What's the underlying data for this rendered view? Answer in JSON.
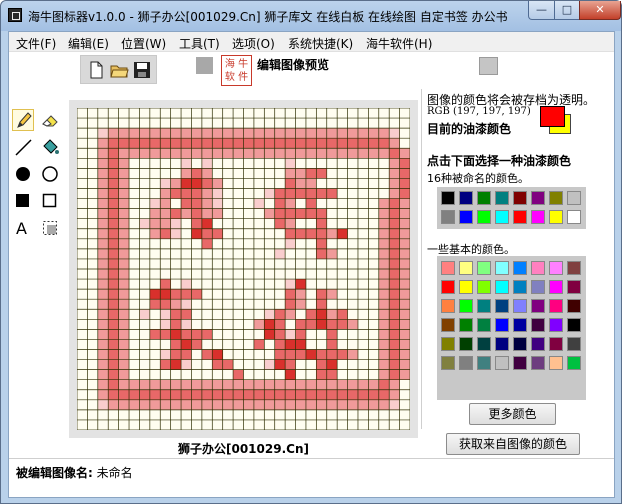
{
  "window": {
    "title": "海牛图标器v1.0.0 - 狮子办公[001029.Cn] 狮子库文 在线白板 在线绘图 自定书签 办公书...",
    "minimize_glyph": "—",
    "maximize_glyph": "□",
    "close_glyph": "✕"
  },
  "menu": {
    "items": [
      {
        "label": "文件(F)"
      },
      {
        "label": "编辑(E)"
      },
      {
        "label": "位置(W)"
      },
      {
        "label": "工具(T)"
      },
      {
        "label": "选项(O)"
      },
      {
        "label": "系统快捷(K)"
      },
      {
        "label": "海牛软件(H)"
      }
    ]
  },
  "toolbar": {
    "new_icon": "new-file-icon",
    "open_icon": "open-folder-icon",
    "save_icon": "save-disk-icon",
    "preview_label": "编辑图像预览",
    "stamp_text": "海牛软件",
    "preview_swatch_color": "#a8a8a8",
    "transparent_swatch_color": "#c5c5c5"
  },
  "tools": [
    {
      "icon": "pencil-icon",
      "selected": true
    },
    {
      "icon": "eraser-icon",
      "selected": false
    },
    {
      "icon": "line-icon",
      "selected": false
    },
    {
      "icon": "fill-bucket-icon",
      "selected": false
    },
    {
      "icon": "filled-circle-icon",
      "selected": false
    },
    {
      "icon": "outline-circle-icon",
      "selected": false
    },
    {
      "icon": "filled-rectangle-icon",
      "selected": false
    },
    {
      "icon": "outline-rectangle-icon",
      "selected": false
    },
    {
      "icon": "text-icon",
      "selected": false
    },
    {
      "icon": "select-region-icon",
      "selected": false
    }
  ],
  "canvas": {
    "grid_size": 32,
    "image_name_label": "狮子办公[001029.Cn]",
    "grid_line_color": "#2d2d00",
    "background_color": "#fffdf0",
    "colors": {
      "r": "#d9302c",
      "m": "#e86868",
      "p": "#f09a9a",
      "l": "#f9cdcd"
    },
    "pixels": [
      "................................",
      "................................",
      "..lpppppppppppppppppppppppppppl..",
      "..pmmmmmmmmmmmmmmmmmmmmmmmmmmmp..",
      "..pmppppppppppppppppppppppppppmp.",
      "..pmp.....l.l.......l.........pm.",
      "..pmp.....pmp.......ppmm......pm.",
      "..pmp...lprrmp......mpp.......pm.",
      "..pmp...pmmmpl....lmmmmmm.....pm.",
      "..pmp..lp.mmpl...l.mp.m......pmp",
      "..pmp..ppmpmpp....pmmmmm.....pmp",
      "..pmp.lppl.mr......mp..m.....pmp",
      "..pmp..pml.rmm......mmmmpr...pmp",
      "..pmp.......m.......l..m.....pmp",
      "..pmp..............l...mp....pmp",
      "..pmp........................pmp",
      "..pmp........................pmp",
      "..pmp...m.l.........lr.......pmp",
      "..pmp..rrmmm........mp.mp....pmp",
      "..pmp..mmpl.........mp.m.....pmp",
      "..pmp.l.lmm.......lmp.mrpm...pmp",
      "..pmp...lml......prm.mmrmmp..pmp",
      "..pmp..mmrmmm.....rmlm..m....pmp",
      "..pmp....mrm.....m.mrr..m....pmp",
      "..pmp...lmm.mr.....mmmrmmmp..pmp",
      "..pmp...mrl..mm...lrm..mr....pmp",
      "..pmp..........m....r..mm....pmp",
      "..pmpppppppppppppppppppppppppmp.",
      "..pmmmmmmmmmmmmmmmmmmmmmmmmmmmp.",
      "..lpppppppppppppppppppppppppppl..",
      "................................",
      "................................"
    ]
  },
  "status": {
    "label": "被编辑图像名:",
    "value": "未命名"
  },
  "right_panel": {
    "transparency_note": "图像的颜色将会被存档为透明。",
    "rgb_text": "RGB (197, 197, 197)",
    "current_color_label": "目前的油漆颜色",
    "current_fg_color": "#ff0000",
    "current_bg_color": "#ffff00",
    "pick_label": "点击下面选择一种油漆颜色",
    "named_colors_label": "16种被命名的颜色。",
    "named_colors": [
      "#000000",
      "#000080",
      "#008000",
      "#008080",
      "#800000",
      "#800080",
      "#808000",
      "#c0c0c0",
      "#808080",
      "#0000ff",
      "#00ff00",
      "#00ffff",
      "#ff0000",
      "#ff00ff",
      "#ffff00",
      "#ffffff"
    ],
    "basic_colors_label": "一些基本的颜色。",
    "basic_colors": [
      "#ff8080",
      "#ffff80",
      "#80ff80",
      "#80ffff",
      "#0080ff",
      "#ff80c0",
      "#ff80ff",
      "#804040",
      "#ff0000",
      "#ffff00",
      "#80ff00",
      "#00ffff",
      "#0080c0",
      "#8080c0",
      "#ff00ff",
      "#800040",
      "#ff8040",
      "#00ff00",
      "#008080",
      "#004080",
      "#8080ff",
      "#800080",
      "#ff0080",
      "#400000",
      "#804000",
      "#008000",
      "#008040",
      "#0000ff",
      "#0000a0",
      "#400040",
      "#8000ff",
      "#000000",
      "#808000",
      "#004000",
      "#004040",
      "#000080",
      "#000040",
      "#400080",
      "#800040",
      "#404040",
      "#808040",
      "#808080",
      "#408080",
      "#c0c0c0",
      "#400040",
      "#6d3d7f",
      "#ffc090",
      "#00c040"
    ],
    "more_colors_button": "更多颜色",
    "pick_from_image_button": "获取来自图像的颜色"
  }
}
